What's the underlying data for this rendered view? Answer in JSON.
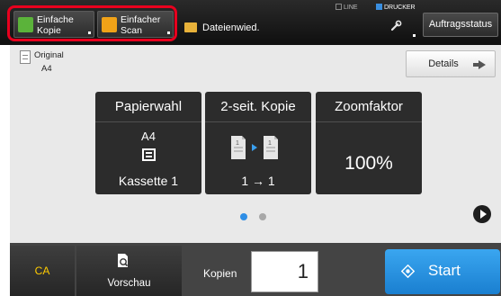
{
  "topbar": {
    "modes": [
      {
        "line1": "Einfache",
        "line2": "Kopie",
        "icon": "copy-mode-icon",
        "color": "#5bb33a"
      },
      {
        "line1": "Einfacher",
        "line2": "Scan",
        "icon": "scan-mode-icon",
        "color": "#f0a218"
      }
    ],
    "highlight_color": "#e8001e",
    "file_retrieve_label": "Dateienwied.",
    "indicators": {
      "line": "LINE",
      "printer": "DRUCKER"
    },
    "job_status_label": "Auftragsstatus"
  },
  "main": {
    "original_label": "Original",
    "original_size": "A4",
    "details_label": "Details",
    "cards": [
      {
        "title": "Papierwahl",
        "line1": "A4",
        "bottom": "Kassette 1",
        "icon": "paper-tray-icon"
      },
      {
        "title": "2-seit. Kopie",
        "bottom": "1 → 1",
        "icon": "duplex-copy-icon"
      },
      {
        "title": "Zoomfaktor",
        "value": "100%"
      }
    ],
    "page_indicator": {
      "current": 1,
      "total": 2
    }
  },
  "bottombar": {
    "ca_label": "CA",
    "preview_label": "Vorschau",
    "copies_label": "Kopien",
    "copies_value": "1",
    "start_label": "Start",
    "start_color": "#2e8ee6"
  }
}
